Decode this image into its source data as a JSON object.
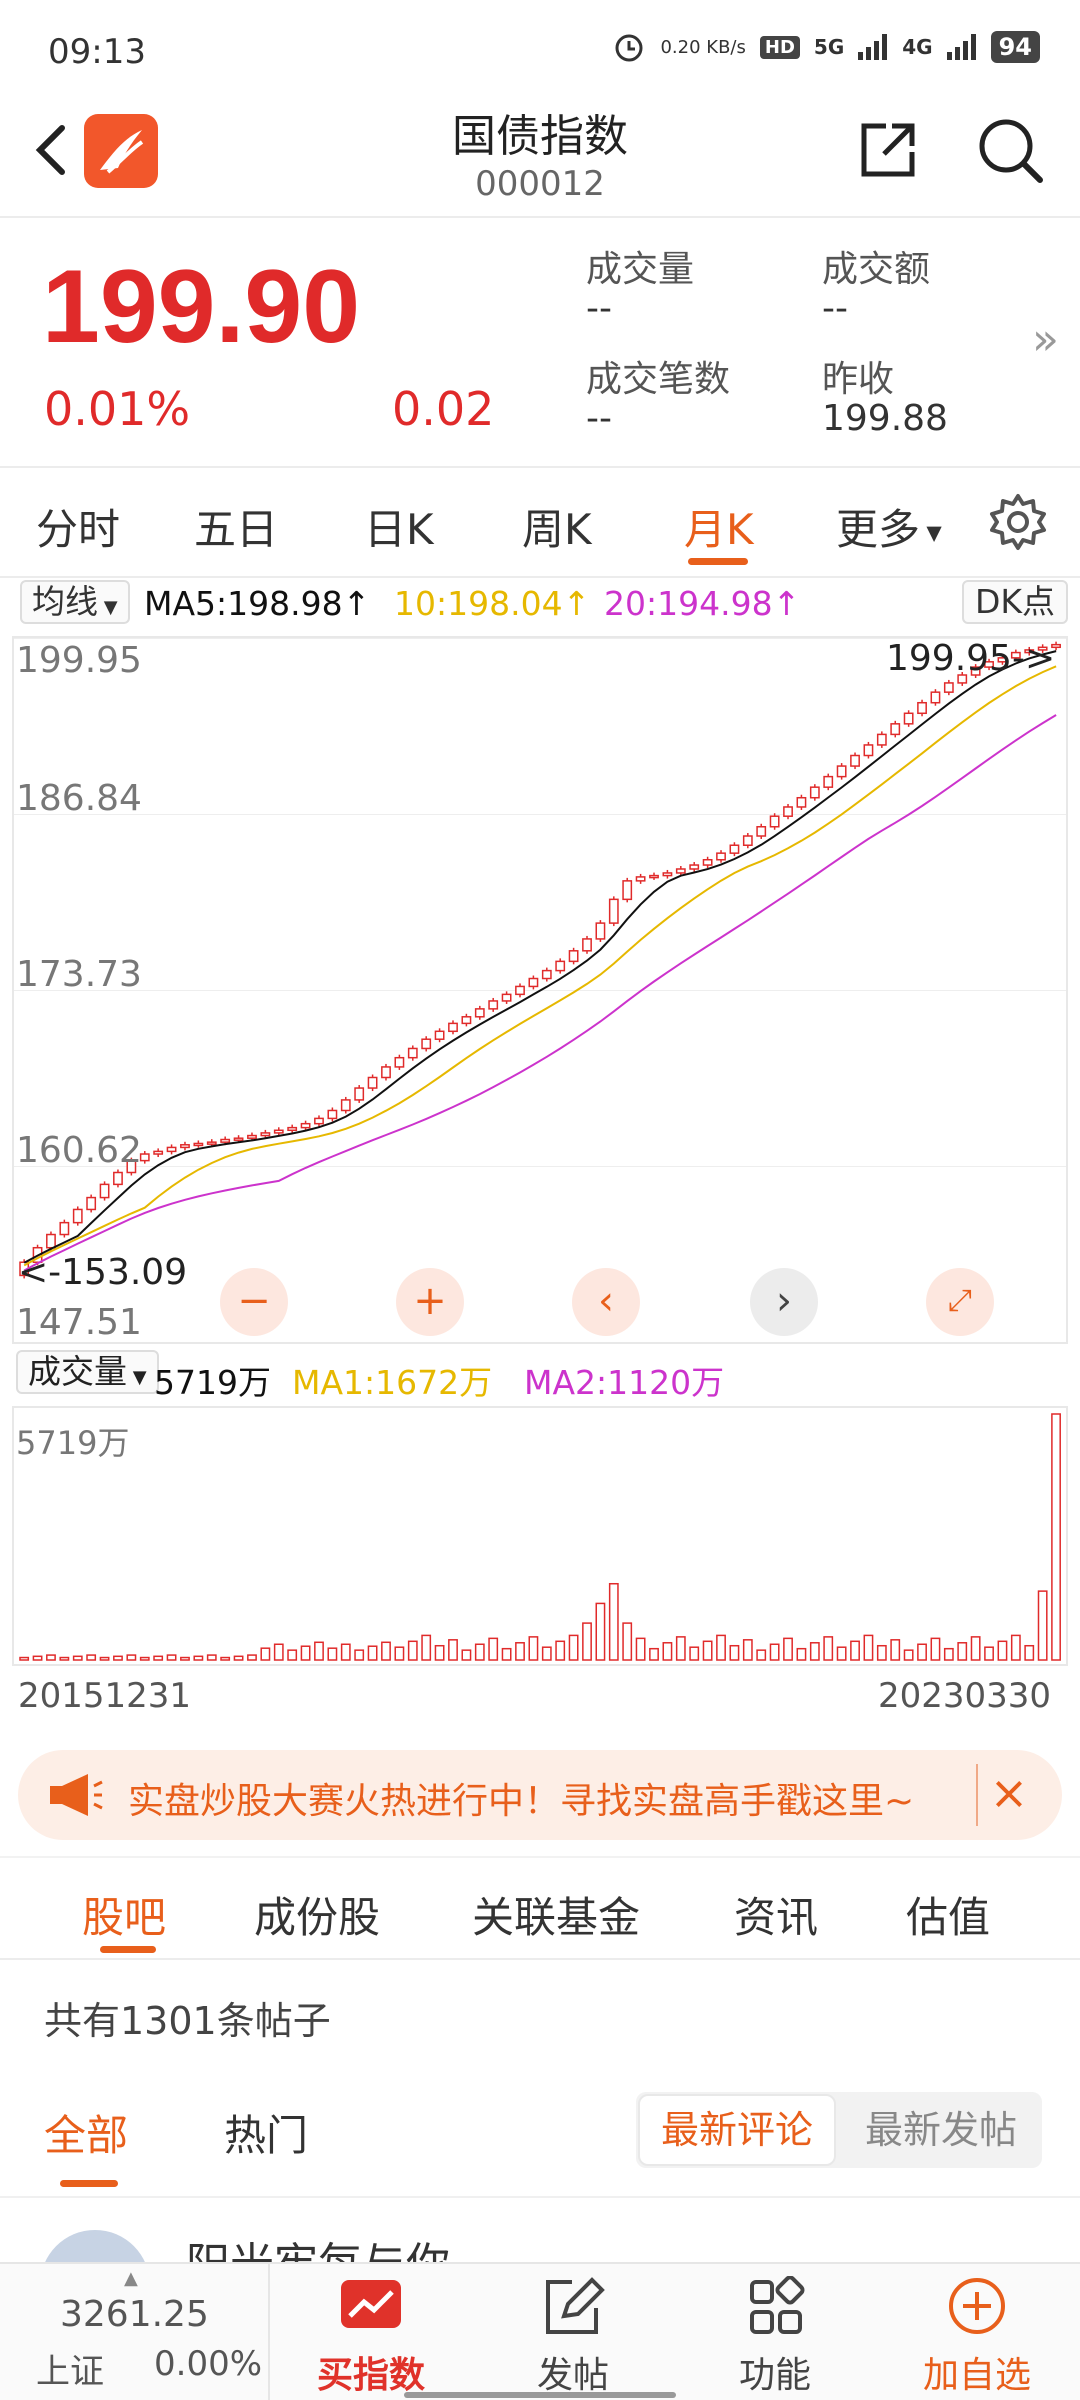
{
  "status": {
    "time": "09:13",
    "net_speed": "0.20 KB/s",
    "network_5g": "5G",
    "network_4g": "4G",
    "hd": "HD",
    "battery": "94"
  },
  "header": {
    "title": "国债指数",
    "code": "000012"
  },
  "quote": {
    "price": "199.90",
    "change_pct": "0.01%",
    "change_val": "0.02",
    "volume_label": "成交量",
    "volume_value": "--",
    "amount_label": "成交额",
    "amount_value": "--",
    "trades_label": "成交笔数",
    "trades_value": "--",
    "prev_close_label": "昨收",
    "prev_close_value": "199.88"
  },
  "tabs": [
    "分时",
    "五日",
    "日K",
    "周K",
    "月K",
    "更多"
  ],
  "active_tab": "月K",
  "ma_bar": {
    "selector": "均线",
    "ma5": "MA5:198.98↑",
    "ma10": "10:198.04↑",
    "ma20": "20:194.98↑",
    "dk_button": "DK点"
  },
  "kline": {
    "y_labels": [
      "199.95",
      "186.84",
      "173.73",
      "160.62",
      "147.51"
    ],
    "max_marker": "199.95->",
    "min_marker": "<-153.09"
  },
  "volume_bar": {
    "selector": "成交量",
    "current": "5719万",
    "ma1": "MA1:1672万",
    "ma2": "MA2:1120万",
    "max_label": "5719万"
  },
  "dates": {
    "start": "20151231",
    "end": "20230330"
  },
  "promo": {
    "text": "实盘炒股大赛火热进行中！寻找实盘高手戳这里~"
  },
  "sub_tabs": [
    "股吧",
    "成份股",
    "关联基金",
    "资讯",
    "估值"
  ],
  "post_count": "共有1301条帖子",
  "filter": {
    "all": "全部",
    "hot": "热门",
    "sort_latest_comment": "最新评论",
    "sort_latest_post": "最新发帖"
  },
  "post_preview": {
    "user": "阳光牢每与你"
  },
  "bottom_nav": {
    "index_value": "3261.25",
    "index_name": "上证",
    "index_pct": "0.00%",
    "buy_index": "买指数",
    "post": "发帖",
    "functions": "功能",
    "add_watchlist": "加自选"
  },
  "colors": {
    "accent": "#e85f1b",
    "up": "#e02a2a",
    "down": "#16a33a",
    "ma5": "#111111",
    "ma10": "#e6b800",
    "ma20": "#cc33cc"
  },
  "chart_data": {
    "type": "candlestick",
    "x_range": [
      "20151231",
      "20230330"
    ],
    "ylim": [
      147.51,
      199.95
    ],
    "monthly_close_approx": [
      153.1,
      154.2,
      155.2,
      156.1,
      157.1,
      158.0,
      159.0,
      159.9,
      160.8,
      161.3,
      161.5,
      161.8,
      162.0,
      162.1,
      162.2,
      162.4,
      162.5,
      162.7,
      162.9,
      163.1,
      163.3,
      163.6,
      164.0,
      164.6,
      165.4,
      166.3,
      167.1,
      167.9,
      168.6,
      169.3,
      170.0,
      170.6,
      171.2,
      171.7,
      172.3,
      172.9,
      173.4,
      174.0,
      174.6,
      175.2,
      175.9,
      176.7,
      177.6,
      178.8,
      180.6,
      182.0,
      182.3,
      182.4,
      182.6,
      182.9,
      183.2,
      183.6,
      184.1,
      184.7,
      185.4,
      186.1,
      186.9,
      187.6,
      188.3,
      189.1,
      189.9,
      190.7,
      191.5,
      192.3,
      193.1,
      193.9,
      194.7,
      195.5,
      196.3,
      197.0,
      197.6,
      198.2,
      198.6,
      198.9,
      199.3,
      199.5,
      199.7,
      199.9
    ]
  }
}
